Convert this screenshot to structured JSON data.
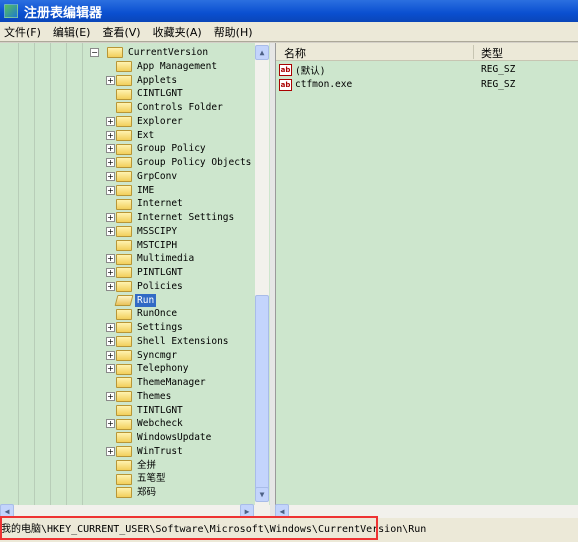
{
  "window": {
    "title": "注册表编辑器",
    "icon": "regedit-icon"
  },
  "menu": [
    "文件(F)",
    "编辑(E)",
    "查看(V)",
    "收藏夹(A)",
    "帮助(H)"
  ],
  "tree": {
    "parent": {
      "label": "CurrentVersion",
      "expanded": true
    },
    "items": [
      {
        "label": "App Management",
        "expandable": false
      },
      {
        "label": "Applets",
        "expandable": true
      },
      {
        "label": "CINTLGNT",
        "expandable": false
      },
      {
        "label": "Controls Folder",
        "expandable": false
      },
      {
        "label": "Explorer",
        "expandable": true
      },
      {
        "label": "Ext",
        "expandable": true
      },
      {
        "label": "Group Policy",
        "expandable": true
      },
      {
        "label": "Group Policy Objects",
        "expandable": true
      },
      {
        "label": "GrpConv",
        "expandable": true
      },
      {
        "label": "IME",
        "expandable": true
      },
      {
        "label": "Internet",
        "expandable": false
      },
      {
        "label": "Internet Settings",
        "expandable": true
      },
      {
        "label": "MSSCIPY",
        "expandable": true
      },
      {
        "label": "MSTCIPH",
        "expandable": false
      },
      {
        "label": "Multimedia",
        "expandable": true
      },
      {
        "label": "PINTLGNT",
        "expandable": true
      },
      {
        "label": "Policies",
        "expandable": true
      },
      {
        "label": "Run",
        "expandable": false,
        "selected": true
      },
      {
        "label": "RunOnce",
        "expandable": false
      },
      {
        "label": "Settings",
        "expandable": true
      },
      {
        "label": "Shell Extensions",
        "expandable": true
      },
      {
        "label": "Syncmgr",
        "expandable": true
      },
      {
        "label": "Telephony",
        "expandable": true
      },
      {
        "label": "ThemeManager",
        "expandable": false
      },
      {
        "label": "Themes",
        "expandable": true
      },
      {
        "label": "TINTLGNT",
        "expandable": false
      },
      {
        "label": "Webcheck",
        "expandable": true
      },
      {
        "label": "WindowsUpdate",
        "expandable": false
      },
      {
        "label": "WinTrust",
        "expandable": true
      },
      {
        "label": "全拼",
        "expandable": false
      },
      {
        "label": "五笔型",
        "expandable": false
      },
      {
        "label": "郑码",
        "expandable": false
      }
    ]
  },
  "values": {
    "columns": [
      "名称",
      "类型"
    ],
    "rows": [
      {
        "name": "(默认)",
        "type": "REG_SZ",
        "icon": "string-value-icon"
      },
      {
        "name": "ctfmon.exe",
        "type": "REG_SZ",
        "icon": "string-value-icon"
      }
    ]
  },
  "status": {
    "path": "我的电脑\\HKEY_CURRENT_USER\\Software\\Microsoft\\Windows\\CurrentVersion\\Run"
  },
  "colors": {
    "pane_bg": "#cde6cd",
    "selection": "#316ac5",
    "highlight_box": "#ee3333"
  }
}
